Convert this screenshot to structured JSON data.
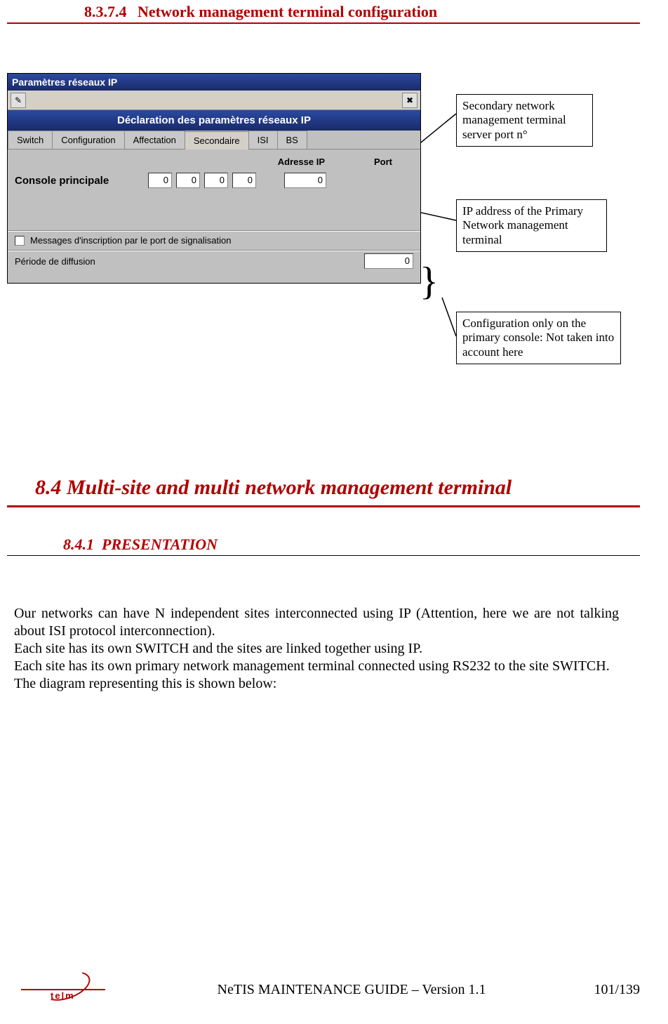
{
  "heading4": {
    "num": "8.3.7.4",
    "title": "Network management terminal configuration"
  },
  "window": {
    "title": "Paramètres réseaux IP",
    "banner": "Déclaration des paramètres réseaux IP",
    "tabs": [
      "Switch",
      "Configuration",
      "Affectation",
      "Secondaire",
      "ISI",
      "BS"
    ],
    "active_tab_index": 3,
    "col_ip": "Adresse IP",
    "col_port": "Port",
    "row_label": "Console principale",
    "ip": [
      "0",
      "0",
      "0",
      "0"
    ],
    "port": "0",
    "chk_label": "Messages d'inscription par le port de signalisation",
    "period_label": "Période de diffusion",
    "period_value": "0"
  },
  "callouts": {
    "c1": "Secondary network management terminal server port n°",
    "c2": "IP address of the Primary Network management terminal",
    "c3": "Configuration only on the primary console:\nNot taken into account here"
  },
  "heading2": {
    "num": "8.4",
    "title": "Multi-site and multi network management terminal"
  },
  "heading3": {
    "num": "8.4.1",
    "title": "PRESENTATION"
  },
  "body": {
    "p1": "Our networks can have N independent sites interconnected using IP (Attention, here we are not talking about ISI protocol interconnection).",
    "p2": "Each site has its own SWITCH and the sites are linked together using IP.",
    "p3": "Each site has its own primary network management terminal connected using RS232 to the site SWITCH.",
    "p4": "The diagram representing this is shown below:"
  },
  "footer": {
    "brand": "telm",
    "title": "NeTIS MAINTENANCE GUIDE – Version 1.1",
    "page": "101/139"
  }
}
